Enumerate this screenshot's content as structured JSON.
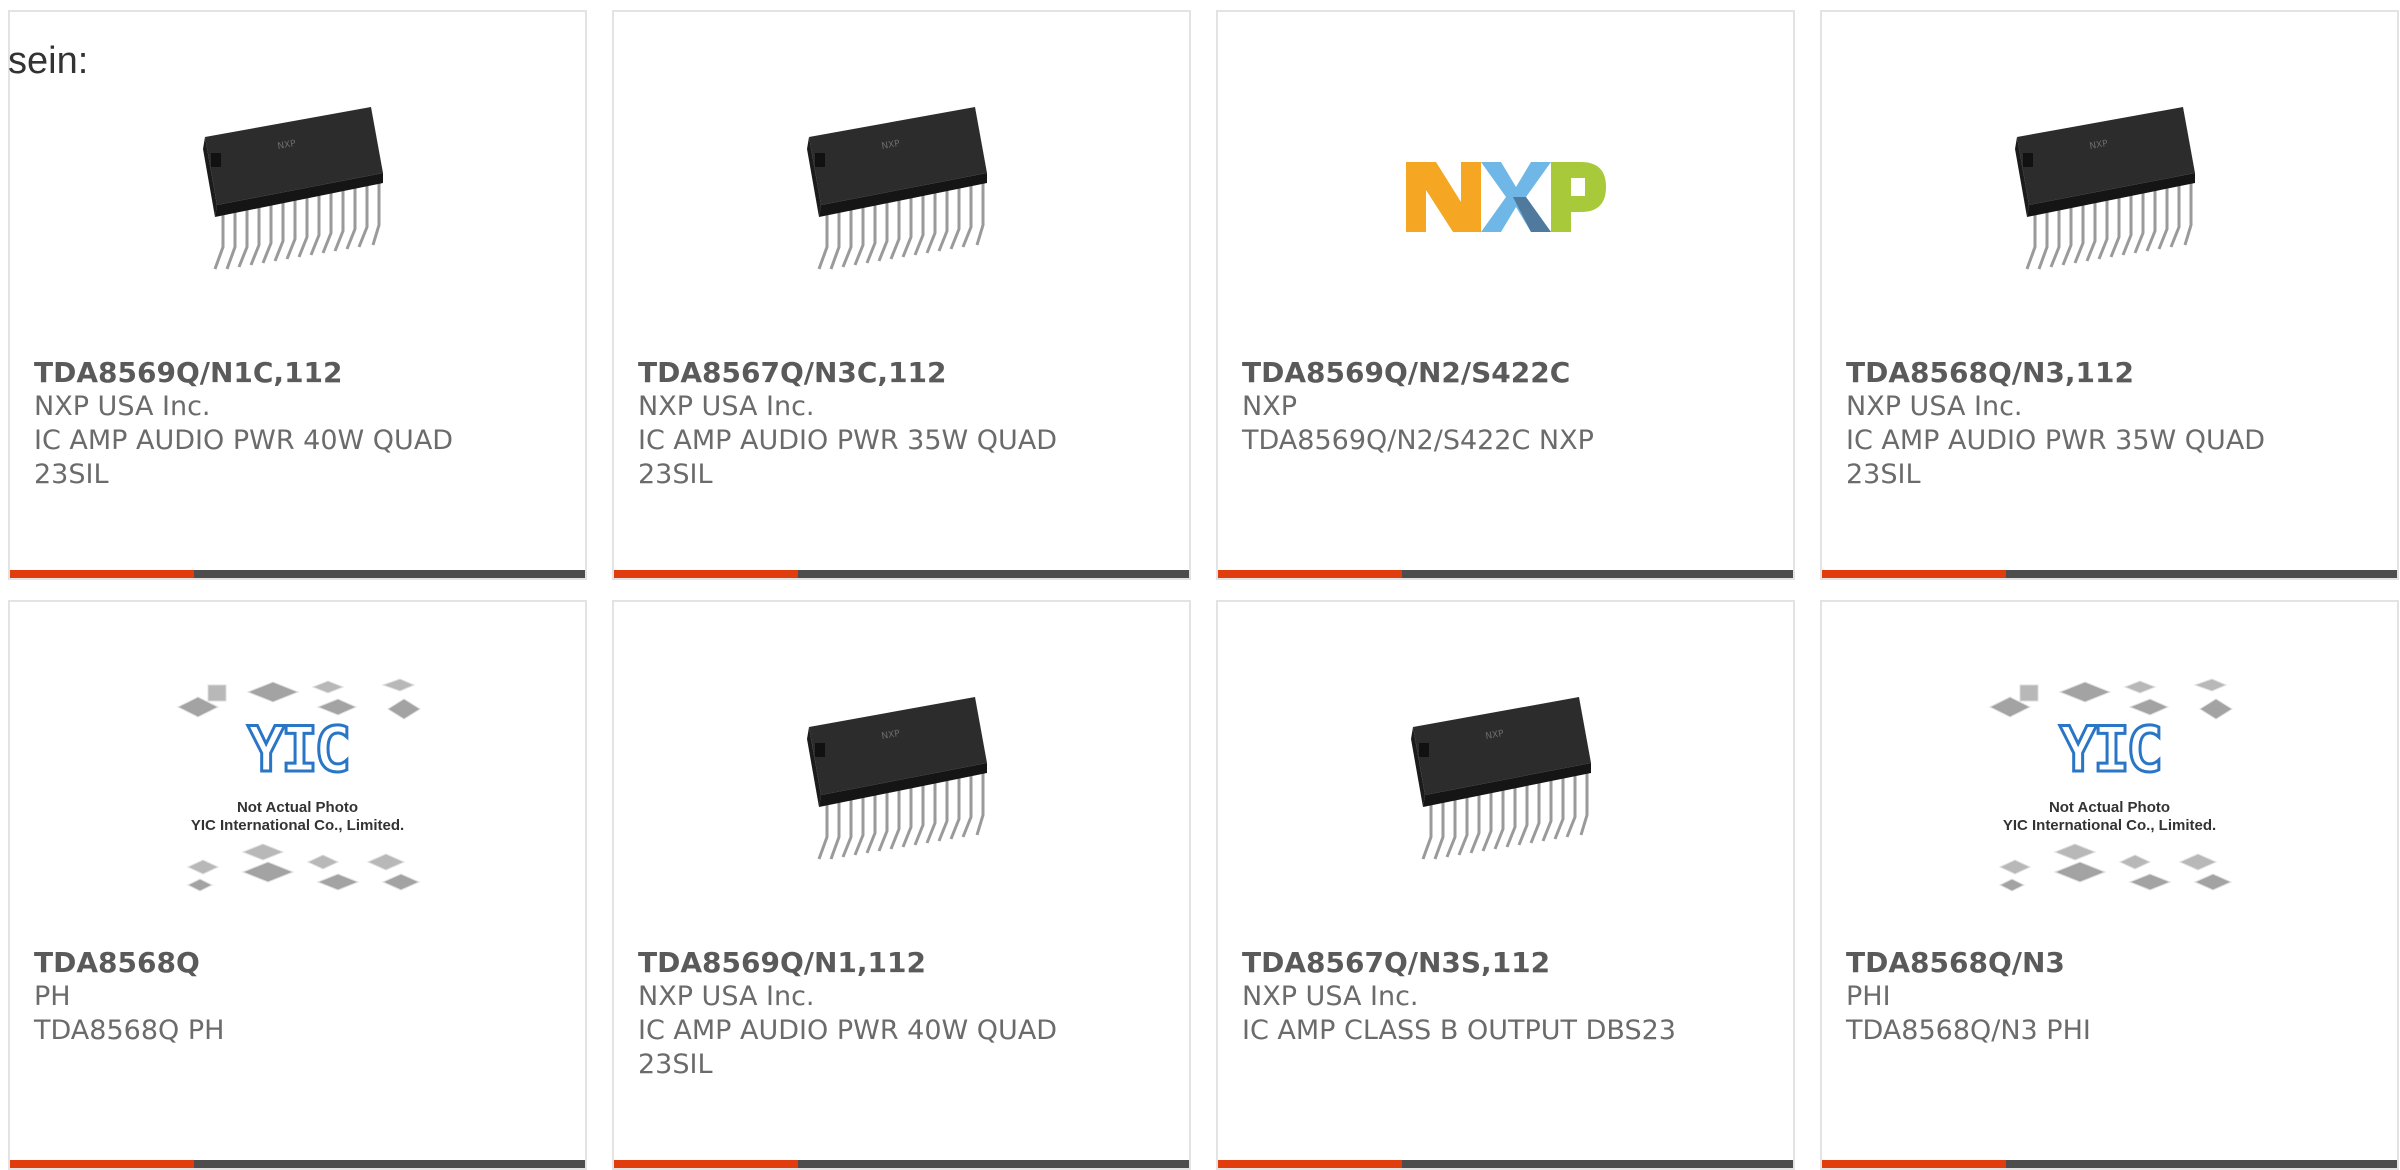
{
  "intro_text": "sein:",
  "colors": {
    "accent_bar": "#e03c0e",
    "bar": "#4d4d4d",
    "card_border": "#e3e3e3",
    "text": "#6b6b6b"
  },
  "products": [
    {
      "part": "TDA8569Q/N1C,112",
      "maker": "NXP USA Inc.",
      "desc1": "IC AMP AUDIO PWR 40W QUAD",
      "desc2": "23SIL",
      "image": "ic-chip"
    },
    {
      "part": "TDA8567Q/N3C,112",
      "maker": "NXP USA Inc.",
      "desc1": "IC AMP AUDIO PWR 35W QUAD",
      "desc2": "23SIL",
      "image": "ic-chip"
    },
    {
      "part": "TDA8569Q/N2/S422C",
      "maker": "NXP",
      "desc1": "TDA8569Q/N2/S422C NXP",
      "desc2": "",
      "image": "nxp-logo"
    },
    {
      "part": "TDA8568Q/N3,112",
      "maker": "NXP USA Inc.",
      "desc1": "IC AMP AUDIO PWR 35W QUAD",
      "desc2": "23SIL",
      "image": "ic-chip"
    },
    {
      "part": "TDA8568Q",
      "maker": "PH",
      "desc1": "TDA8568Q PH",
      "desc2": "",
      "image": "yic-placeholder"
    },
    {
      "part": "TDA8569Q/N1,112",
      "maker": "NXP USA Inc.",
      "desc1": "IC AMP AUDIO PWR 40W QUAD",
      "desc2": "23SIL",
      "image": "ic-chip"
    },
    {
      "part": "TDA8567Q/N3S,112",
      "maker": "NXP USA Inc.",
      "desc1": "IC AMP CLASS B OUTPUT DBS23",
      "desc2": "",
      "image": "ic-chip"
    },
    {
      "part": "TDA8568Q/N3",
      "maker": "PHI",
      "desc1": "TDA8568Q/N3 PHI",
      "desc2": "",
      "image": "yic-placeholder"
    }
  ],
  "yic_placeholder": {
    "logo_text": "YIC",
    "caption1": "Not Actual Photo",
    "caption2": "YIC International Co., Limited."
  },
  "nxp_logo_text": "NXP"
}
